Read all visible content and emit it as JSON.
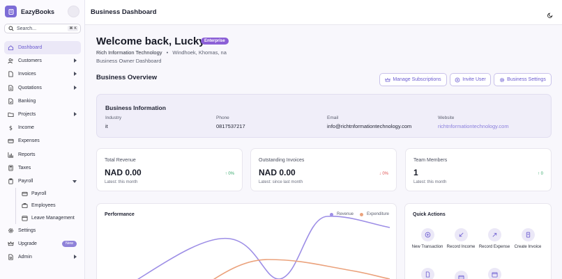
{
  "brand": {
    "name": "EazyBooks"
  },
  "search": {
    "placeholder": "Search...",
    "shortcut": "⌘ K"
  },
  "sidebar": {
    "items": [
      {
        "label": "Dashboard",
        "icon": "home-icon",
        "active": true
      },
      {
        "label": "Customers",
        "icon": "users-icon",
        "expandable": true
      },
      {
        "label": "Invoices",
        "icon": "file-icon",
        "expandable": true
      },
      {
        "label": "Quotations",
        "icon": "file-text-icon",
        "expandable": true
      },
      {
        "label": "Banking",
        "icon": "bank-icon"
      },
      {
        "label": "Projects",
        "icon": "folder-icon",
        "expandable": true
      },
      {
        "label": "Income",
        "icon": "dollar-icon"
      },
      {
        "label": "Expenses",
        "icon": "credit-card-icon"
      },
      {
        "label": "Reports",
        "icon": "bar-chart-icon"
      },
      {
        "label": "Taxes",
        "icon": "calculator-icon"
      },
      {
        "label": "Payroll",
        "icon": "clipboard-icon",
        "expanded": true
      }
    ],
    "payroll_sub": [
      {
        "label": "Payroll",
        "icon": "wallet-icon"
      },
      {
        "label": "Employees",
        "icon": "briefcase-icon"
      },
      {
        "label": "Leave Management",
        "icon": "calendar-icon"
      }
    ],
    "bottom_items": [
      {
        "label": "Settings",
        "icon": "gear-icon"
      },
      {
        "label": "Upgrade",
        "icon": "crown-icon",
        "badge": "New"
      },
      {
        "label": "Admin",
        "icon": "shield-icon",
        "expandable": true
      }
    ]
  },
  "header": {
    "title": "Business Dashboard"
  },
  "welcome": {
    "greeting": "Welcome back, Lucky",
    "plan": "Enterprise",
    "org": "Rich Information Technology",
    "separator": "•",
    "location": "Windhoek, Khomas, na",
    "subtitle": "Business Owner Dashboard"
  },
  "overview": {
    "title": "Business Overview",
    "buttons": {
      "manage_subscriptions": "Manage Subscriptions",
      "invite_user": "Invite User",
      "business_settings": "Business Settings"
    }
  },
  "business_info": {
    "title": "Business Information",
    "fields": [
      {
        "label": "Industry",
        "value": "it"
      },
      {
        "label": "Phone",
        "value": "0817537217"
      },
      {
        "label": "Email",
        "value": "info@richtnformationtechnology.com"
      },
      {
        "label": "Website",
        "value": "richtnformationtechnology.com"
      }
    ]
  },
  "stats": [
    {
      "label": "Total Revenue",
      "value": "NAD 0.00",
      "sub": "Latest: this month",
      "delta": "↑ 0%",
      "trend": "up"
    },
    {
      "label": "Outstanding Invoices",
      "value": "NAD 0.00",
      "sub": "Latest: since last month",
      "delta": "↓ 0%",
      "trend": "down"
    },
    {
      "label": "Team Members",
      "value": "1",
      "sub": "Latest: this month",
      "delta": "↑ 0",
      "trend": "up"
    }
  ],
  "performance": {
    "title": "Performance",
    "legend": [
      {
        "label": "Revenue",
        "color": "#9d8ee6"
      },
      {
        "label": "Expenditure",
        "color": "#eba27c"
      }
    ]
  },
  "quick_actions": {
    "title": "Quick Actions",
    "items": [
      {
        "label": "New Transaction",
        "icon": "plus-circle-icon"
      },
      {
        "label": "Record Income",
        "icon": "arrow-down-left-icon"
      },
      {
        "label": "Record Expense",
        "icon": "arrow-up-right-icon"
      },
      {
        "label": "Create Invoice",
        "icon": "receipt-icon"
      }
    ]
  },
  "colors": {
    "accent": "#7c6cd6",
    "sidebar_bg": "#fbfafe",
    "main_bg": "#f8f7fc",
    "enterprise_badge": "#8b5fd6"
  }
}
